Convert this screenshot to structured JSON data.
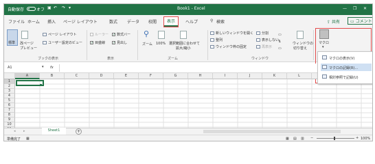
{
  "titlebar": {
    "autosave_label": "自動保存",
    "autosave_state": "オフ",
    "book_title": "Book1 - Excel",
    "search_placeholder": "検索",
    "min": "—",
    "restore": "❐",
    "close": "✕",
    "colors": {
      "bar": "#217346"
    }
  },
  "tabs": [
    "ファイル",
    "ホーム",
    "挿入",
    "ページ レイアウト",
    "数式",
    "データ",
    "校閲",
    "表示",
    "ヘルプ"
  ],
  "tab_active": "表示",
  "tell_me": "検索",
  "share": "共有",
  "comment": "コメント",
  "ribbon": {
    "book_views": {
      "normal": "標準",
      "page_break_1": "改ページ",
      "page_break_2": "プレビュー",
      "page_layout": "ページ レイアウト",
      "custom_views": "ユーザー設定のビュー",
      "group": "ブックの表示"
    },
    "show": {
      "ruler": "ルーラー",
      "formula_bar": "数式バー",
      "gridlines": "目盛線",
      "headings": "見出し",
      "group": "表示"
    },
    "zoom": {
      "zoom": "ズーム",
      "zoom100": "100%",
      "zoom_selection_1": "選択範囲に合わせて",
      "zoom_selection_2": "拡大/縮小",
      "group": "ズーム"
    },
    "window": {
      "new_window": "新しいウィンドウを開く",
      "arrange": "整列",
      "freeze": "ウィンドウ枠の固定",
      "split": "分割",
      "hide": "表示しない",
      "unhide": "再表示",
      "switch_1": "ウィンドウの",
      "switch_2": "切り替え",
      "group": "ウィンドウ"
    },
    "macros": {
      "label": "マクロ",
      "caret": "▾"
    }
  },
  "macro_menu": [
    {
      "label": "マクロの表示(V)",
      "icon": "macro-view-icon",
      "highlighted": false
    },
    {
      "label": "マクロの記録(R)...",
      "icon": "record-macro-icon",
      "highlighted": true
    },
    {
      "label": "相対参照で記録(U)",
      "icon": "relative-ref-icon",
      "highlighted": false
    }
  ],
  "formula_bar": {
    "name_box": "A1",
    "fx": "fx"
  },
  "columns": [
    "A",
    "B",
    "C",
    "D",
    "E",
    "F",
    "G",
    "H",
    "I",
    "J",
    "K",
    "L",
    "M",
    "N"
  ],
  "rows": [
    "1",
    "2",
    "3",
    "4",
    "5",
    "6",
    "7",
    "8",
    "9",
    "10",
    "11"
  ],
  "sheet_tab": "Sheet1",
  "add_sheet": "+",
  "status": {
    "ready": "準備完了",
    "zoom": "100%"
  }
}
